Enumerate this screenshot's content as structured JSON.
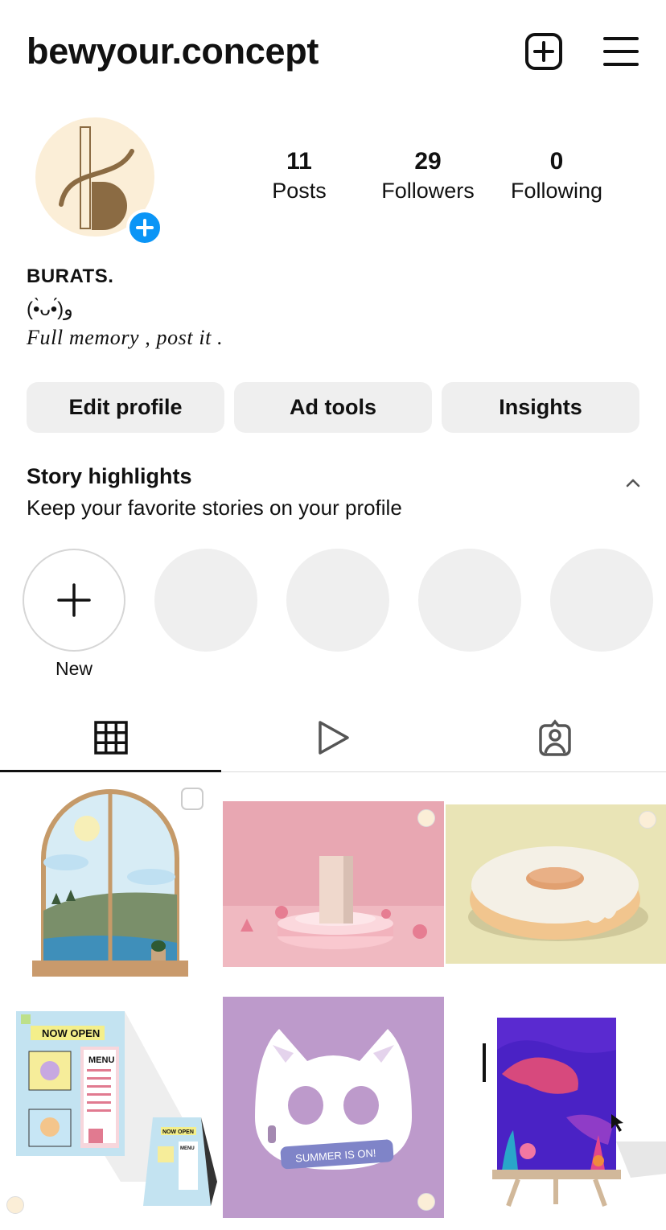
{
  "header": {
    "username": "bewyour.concept",
    "new_post_icon": "plus-square-icon",
    "menu_icon": "hamburger-menu-icon"
  },
  "profile": {
    "stats": [
      {
        "value": "11",
        "label": "Posts"
      },
      {
        "value": "29",
        "label": "Followers"
      },
      {
        "value": "0",
        "label": "Following"
      }
    ],
    "name": "BURATS.",
    "kaomoji": "(•̀ᴗ•́)و",
    "bio": "Full memory , post it ."
  },
  "actions": {
    "edit": "Edit profile",
    "ad_tools": "Ad tools",
    "insights": "Insights"
  },
  "highlights": {
    "title": "Story highlights",
    "subtitle": "Keep your favorite stories on your profile",
    "new_label": "New"
  },
  "tabs": [
    {
      "icon": "grid-icon",
      "active": true
    },
    {
      "icon": "reels-play-icon",
      "active": false
    },
    {
      "icon": "tagged-person-icon",
      "active": false
    }
  ],
  "colors": {
    "accent": "#0b95f6",
    "button_bg": "#efefef",
    "avatar_bg": "#fbeed7",
    "logo_brown": "#8b6b43"
  },
  "grid_posts": [
    {
      "subject": "arched window landscape illustration"
    },
    {
      "subject": "pink podium 3D render"
    },
    {
      "subject": "glazed donut 3D render"
    },
    {
      "subject": "ice-cream shop menu flyer",
      "text": [
        "NOW OPEN",
        "MENU",
        "NOW OPEN",
        "MENU"
      ]
    },
    {
      "subject": "cat mascot with headset",
      "text": [
        "SUMMER IS ON!"
      ]
    },
    {
      "subject": "underwater whale poster on easel"
    }
  ]
}
